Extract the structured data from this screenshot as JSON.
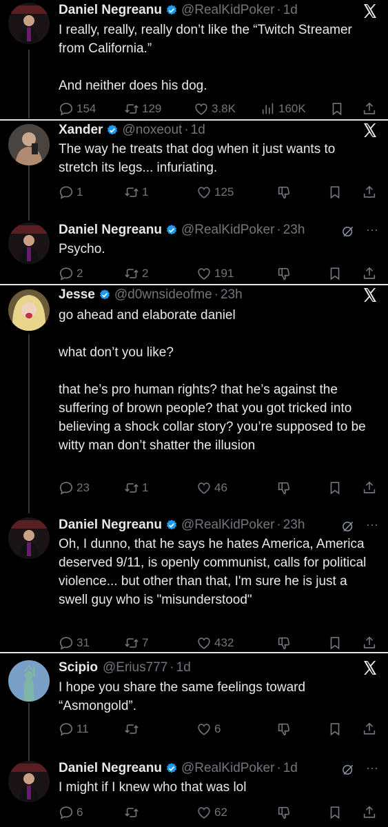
{
  "tweets": [
    {
      "name": "Daniel Negreanu",
      "handle": "@RealKidPoker",
      "time": "1d",
      "text": "I really, really, really don’t like the “Twitch Streamer from California.”\n\nAnd neither does his dog.",
      "replies": "154",
      "reposts": "129",
      "likes": "3.8K",
      "views": "160K"
    },
    {
      "name": "Xander",
      "handle": "@noxeout",
      "time": "1d",
      "text": "The way he treats that dog when it just wants to stretch its legs... infuriating.",
      "replies": "1",
      "reposts": "1",
      "likes": "125"
    },
    {
      "name": "Daniel Negreanu",
      "handle": "@RealKidPoker",
      "time": "23h",
      "text": "Psycho.",
      "replies": "2",
      "reposts": "2",
      "likes": "191"
    },
    {
      "name": "Jesse",
      "handle": "@d0wnsideofme",
      "time": "23h",
      "text": "go ahead and elaborate daniel\n\nwhat don’t you like?\n\nthat he’s pro human rights? that he’s against the suffering of brown people? that you got tricked into believing a shock collar story? you’re supposed to be witty man don’t shatter the illusion",
      "replies": "23",
      "reposts": "1",
      "likes": "46"
    },
    {
      "name": "Daniel Negreanu",
      "handle": "@RealKidPoker",
      "time": "23h",
      "text": "Oh, I dunno, that he says he hates America, America deserved 9/11, is openly communist, calls for political violence... but other than that, I'm sure he is just a swell guy who is \"misunderstood\"",
      "replies": "31",
      "reposts": "7",
      "likes": "432"
    },
    {
      "name": "Scipio",
      "handle": "@Erius777",
      "time": "1d",
      "text": "I hope you share the same feelings toward “Asmongold”.",
      "replies": "11",
      "reposts": "",
      "likes": "6"
    },
    {
      "name": "Daniel Negreanu",
      "handle": "@RealKidPoker",
      "time": "1d",
      "text": "I might if I knew who that was lol",
      "replies": "6",
      "reposts": "",
      "likes": "62"
    }
  ],
  "dot": "·",
  "colors": {
    "background": "#000000",
    "text": "#e7e9ea",
    "muted": "#71767b",
    "verified": "#1d9bf0"
  }
}
